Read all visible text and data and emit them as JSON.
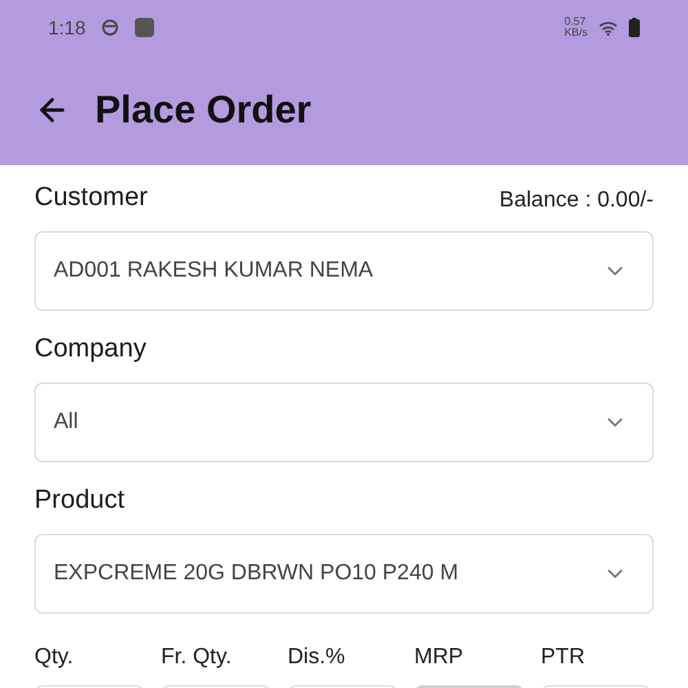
{
  "status_bar": {
    "time": "1:18",
    "speed_value": "0.57",
    "speed_unit": "KB/s"
  },
  "app_bar": {
    "title": "Place Order"
  },
  "customer": {
    "label": "Customer",
    "balance": "Balance : 0.00/-",
    "value": "AD001 RAKESH KUMAR NEMA"
  },
  "company": {
    "label": "Company",
    "value": "All"
  },
  "product": {
    "label": "Product",
    "value": "EXPCREME 20G DBRWN PO10 P240 M"
  },
  "fields": [
    {
      "label": "Qty.",
      "disabled": false
    },
    {
      "label": "Fr. Qty.",
      "disabled": false
    },
    {
      "label": "Dis.%",
      "disabled": false
    },
    {
      "label": "MRP",
      "disabled": true
    },
    {
      "label": "PTR",
      "disabled": false
    }
  ]
}
